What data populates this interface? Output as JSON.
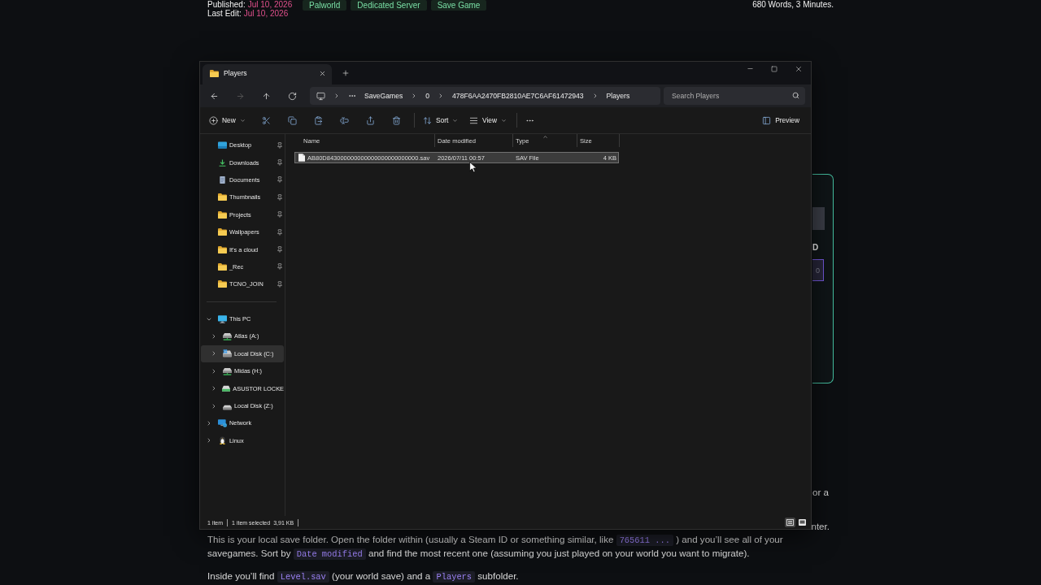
{
  "article": {
    "meta": [
      {
        "label": "Published:",
        "date": "Jul 10, 2026"
      },
      {
        "label": "Last Edit:",
        "date": "Jul 10, 2026"
      }
    ],
    "tags": [
      "Palworld",
      "Dedicated Server",
      "Save Game"
    ],
    "reading_stats": "680 Words, 3 Minutes.",
    "card_fragment": {
      "label": "D",
      "placeholder": "0"
    },
    "text_fragments": [
      "or a",
      "nter."
    ],
    "paragraphs": [
      [
        {
          "kind": "text",
          "text": "This is your local save folder. Open the folder within (usually a Steam ID or something similar, like "
        },
        {
          "kind": "code",
          "text": "765611 ..."
        },
        {
          "kind": "text",
          "text": " ) and you’ll see all of your savegames. Sort by "
        },
        {
          "kind": "code",
          "text": "Date modified"
        },
        {
          "kind": "text",
          "text": " and find the most recent one (assuming you just played on your world you want to migrate)."
        }
      ],
      [
        {
          "kind": "text",
          "text": "Inside you’ll find "
        },
        {
          "kind": "code",
          "text": "Level.sav"
        },
        {
          "kind": "text",
          "text": " (your world save) and a "
        },
        {
          "kind": "code",
          "text": "Players"
        },
        {
          "kind": "text",
          "text": " subfolder."
        }
      ]
    ]
  },
  "explorer": {
    "tabs": [
      {
        "label": "Players",
        "selected": true
      }
    ],
    "nav": [
      {
        "kind": "back",
        "disabled": false
      },
      {
        "kind": "forward",
        "disabled": true
      },
      {
        "kind": "up",
        "disabled": false
      },
      {
        "kind": "refresh",
        "disabled": false
      }
    ],
    "breadcrumbs": [
      "SaveGames",
      "0",
      "478F6AA2470FB2810AE7C6AF61472943",
      "Players"
    ],
    "search": {
      "placeholder": "Search Players"
    },
    "toolbar": [
      {
        "kind": "new",
        "label": "New"
      },
      {
        "kind": "cut"
      },
      {
        "kind": "copy"
      },
      {
        "kind": "paste"
      },
      {
        "kind": "rename"
      },
      {
        "kind": "share"
      },
      {
        "kind": "delete"
      },
      {
        "kind": "sort",
        "label": "Sort"
      },
      {
        "kind": "view",
        "label": "View"
      },
      {
        "kind": "more"
      }
    ],
    "preview": {
      "label": "Preview"
    },
    "sidebar": {
      "quick_access": [
        {
          "kind": "desktop",
          "label": "Desktop",
          "pinned": true
        },
        {
          "kind": "downloads",
          "label": "Downloads",
          "pinned": true
        },
        {
          "kind": "documents",
          "label": "Documents",
          "pinned": true
        },
        {
          "kind": "folder",
          "label": "Thumbnails",
          "pinned": true
        },
        {
          "kind": "folder",
          "label": "Projects",
          "pinned": true
        },
        {
          "kind": "folder",
          "label": "Wallpapers",
          "pinned": true
        },
        {
          "kind": "folder",
          "label": "It's a cloud",
          "pinned": true
        },
        {
          "kind": "folder",
          "label": "_Rec",
          "pinned": true
        },
        {
          "kind": "folder",
          "label": "TCNO_JOIN",
          "pinned": true
        }
      ],
      "tree": [
        {
          "kind": "pc",
          "label": "This PC",
          "expanded": true,
          "selected": false,
          "children": [
            {
              "kind": "network-drive",
              "label": "Atlas (A:)",
              "expanded": false,
              "selected": false
            },
            {
              "kind": "system-drive",
              "label": "Local Disk (C:)",
              "expanded": false,
              "selected": true
            },
            {
              "kind": "network-drive",
              "label": "Midas (H:)",
              "expanded": false,
              "selected": false
            },
            {
              "kind": "nas",
              "label": "ASUSTOR LOCKE",
              "expanded": false,
              "selected": false
            },
            {
              "kind": "drive",
              "label": "Local Disk (Z:)",
              "expanded": false,
              "selected": false
            }
          ]
        },
        {
          "kind": "network",
          "label": "Network",
          "expanded": false,
          "selected": false
        },
        {
          "kind": "linux",
          "label": "Linux",
          "expanded": false,
          "selected": false
        }
      ]
    },
    "columns": [
      {
        "label": "Name",
        "sorted": false
      },
      {
        "label": "Date modified",
        "sorted": false
      },
      {
        "label": "Type",
        "sorted": true
      },
      {
        "label": "Size",
        "sorted": false
      }
    ],
    "files": [
      {
        "name": "AB80D843000000000000000000000000.sav",
        "date_modified": "2026/07/11 00:57",
        "type": "SAV File",
        "size": "4 KB",
        "selected": true
      }
    ],
    "status_bar": {
      "item_count": "1 item",
      "selection": "1 item selected",
      "selection_size": "3,91 KB",
      "views": [
        {
          "kind": "details",
          "selected": true
        },
        {
          "kind": "large-icons",
          "selected": false
        }
      ]
    }
  }
}
